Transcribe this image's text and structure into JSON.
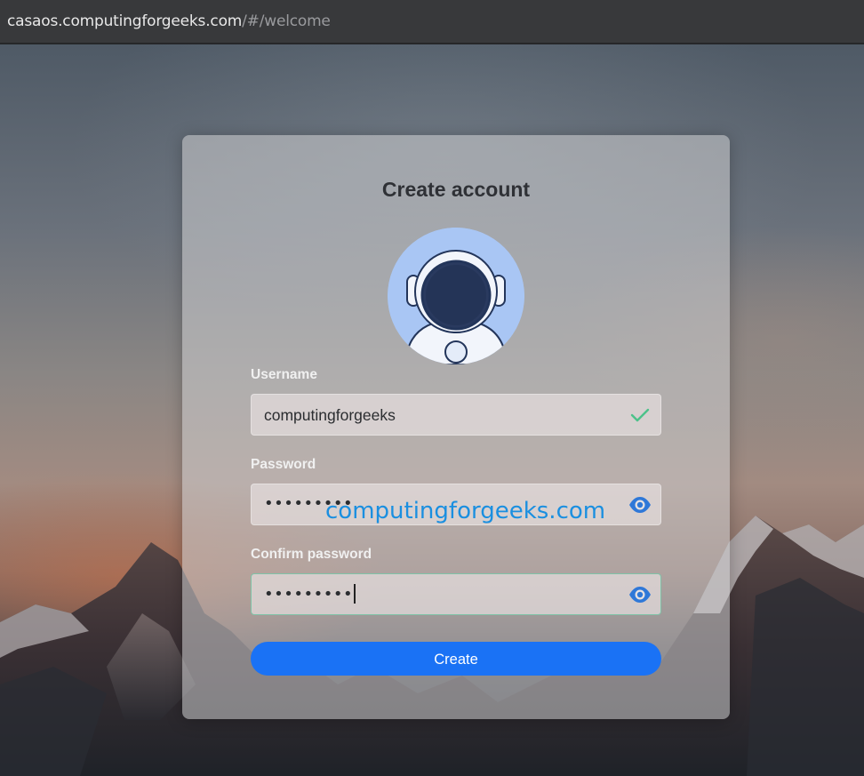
{
  "browser": {
    "url_host": "casaos.computingforgeeks.com",
    "url_path": "/#/welcome"
  },
  "form": {
    "title": "Create account",
    "username": {
      "label": "Username",
      "value": "computingforgeeks",
      "status_icon": "check-icon"
    },
    "password": {
      "label": "Password",
      "masked_value": "•••••••••",
      "toggle_icon": "eye-icon"
    },
    "confirm_password": {
      "label": "Confirm password",
      "masked_value": "•••••••••",
      "toggle_icon": "eye-icon"
    },
    "submit_label": "Create"
  },
  "watermark": "computingforgeeks.com",
  "colors": {
    "primary": "#1a72f5",
    "success": "#4cc28a",
    "eye": "#2f78d8",
    "watermark": "#1a8fe0"
  }
}
